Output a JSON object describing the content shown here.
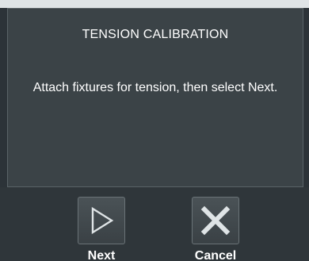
{
  "dialog": {
    "title": "TENSION CALIBRATION",
    "message": "Attach fixtures for tension, then select Next."
  },
  "actions": {
    "next": {
      "label": "Next",
      "icon": "play-triangle-icon"
    },
    "cancel": {
      "label": "Cancel",
      "icon": "close-x-icon"
    }
  },
  "colors": {
    "background": "#2c3338",
    "panel": "#3b4347",
    "text": "#ffffff",
    "icon_glyph": "#dfe4e6"
  }
}
